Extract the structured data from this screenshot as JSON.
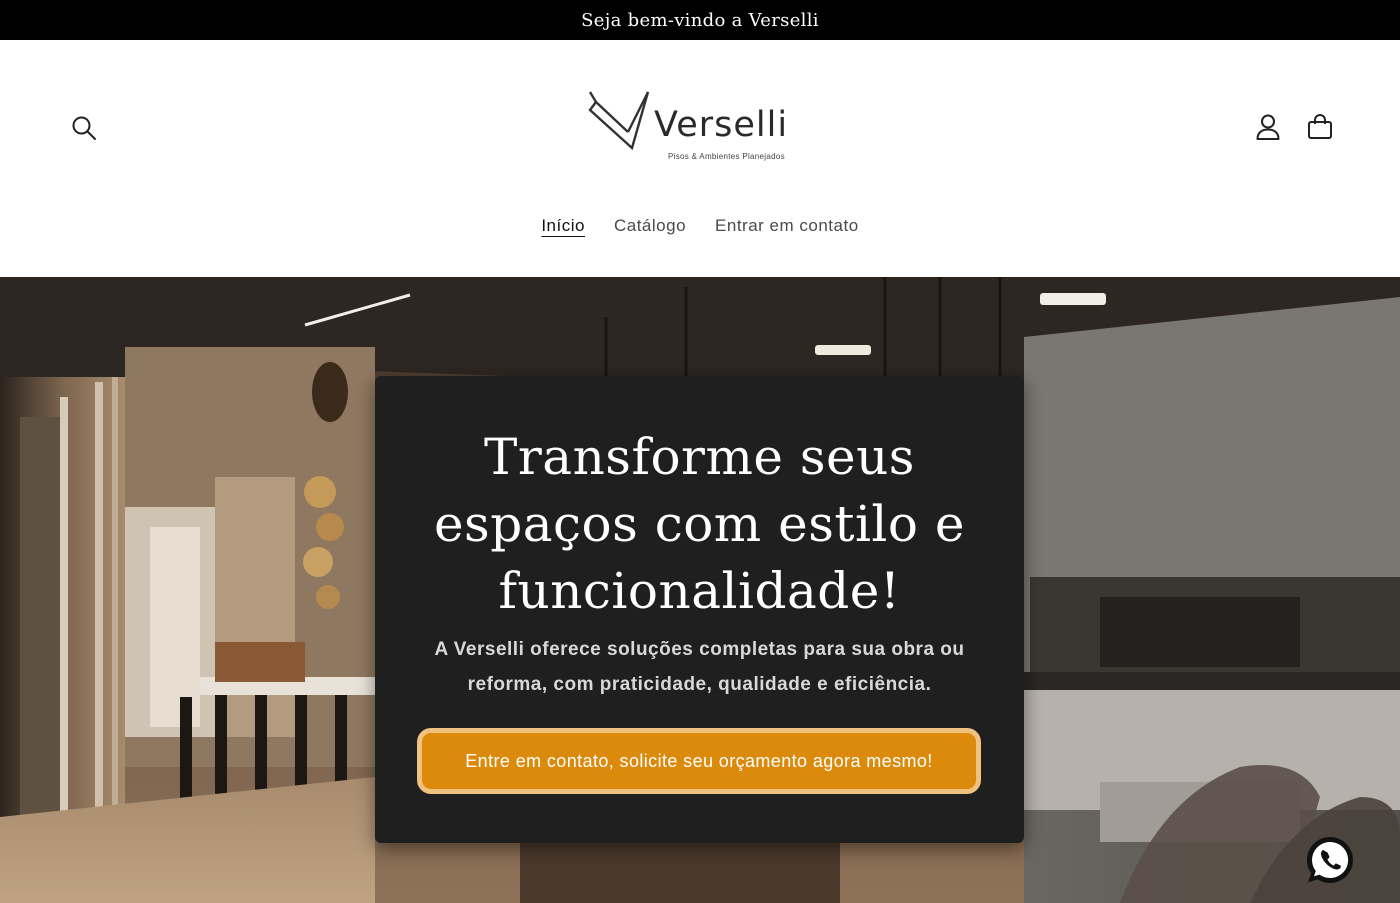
{
  "announcement": {
    "text": "Seja bem-vindo a Verselli"
  },
  "brand": {
    "name": "Verselli",
    "tagline": "Pisos & Ambientes Planejados"
  },
  "nav": {
    "items": [
      {
        "label": "Início",
        "active": true
      },
      {
        "label": "Catálogo",
        "active": false
      },
      {
        "label": "Entrar em contato",
        "active": false
      }
    ]
  },
  "header_icons": [
    "search-icon",
    "account-icon",
    "cart-icon"
  ],
  "hero": {
    "headline": "Transforme seus espaços com estilo e funcionalidade!",
    "subtext": "A Verselli oferece soluções completas para sua obra ou reforma, com praticidade, qualidade e eficiência.",
    "cta_label": "Entre em contato, solicite seu orçamento agora mesmo!"
  },
  "floating": {
    "icon": "whatsapp-icon"
  },
  "colors": {
    "announcement_bg": "#000000",
    "card_bg": "#1f1f1f",
    "cta_bg": "#dc8a0c",
    "cta_border": "#f0c27f"
  }
}
